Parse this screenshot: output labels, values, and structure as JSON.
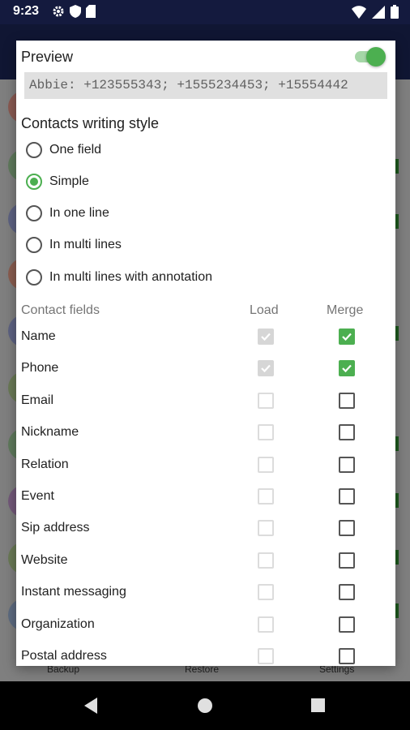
{
  "status_bar": {
    "time": "9:23",
    "left_icons": [
      "gear-icon",
      "shield-icon",
      "sd-card-icon"
    ],
    "right_icons": [
      "wifi-icon",
      "signal-icon",
      "battery-icon"
    ]
  },
  "background_tabs": [
    "Backup",
    "Restore",
    "Settings"
  ],
  "dialog": {
    "preview_title": "Preview",
    "preview_enabled": true,
    "preview_text": "Abbie: +123555343; +1555234453; +15554442",
    "writing_style_title": "Contacts writing style",
    "writing_styles": [
      {
        "label": "One field",
        "selected": false
      },
      {
        "label": "Simple",
        "selected": true
      },
      {
        "label": "In one line",
        "selected": false
      },
      {
        "label": "In multi lines",
        "selected": false
      },
      {
        "label": "In multi lines with annotation",
        "selected": false
      }
    ],
    "columns": {
      "fields": "Contact fields",
      "load": "Load",
      "merge": "Merge"
    },
    "fields": [
      {
        "label": "Name",
        "load": true,
        "merge": true
      },
      {
        "label": "Phone",
        "load": true,
        "merge": true
      },
      {
        "label": "Email",
        "load": false,
        "merge": false
      },
      {
        "label": "Nickname",
        "load": false,
        "merge": false
      },
      {
        "label": "Relation",
        "load": false,
        "merge": false
      },
      {
        "label": "Event",
        "load": false,
        "merge": false
      },
      {
        "label": "Sip address",
        "load": false,
        "merge": false
      },
      {
        "label": "Website",
        "load": false,
        "merge": false
      },
      {
        "label": "Instant messaging",
        "load": false,
        "merge": false
      },
      {
        "label": "Organization",
        "load": false,
        "merge": false
      },
      {
        "label": "Postal address",
        "load": false,
        "merge": false
      }
    ]
  },
  "colors": {
    "accent": "#4caf50",
    "status_bar": "#141a3e",
    "scrim_background": "#7f7f7f"
  },
  "nav_bar": [
    "back-icon",
    "home-icon",
    "recents-icon"
  ]
}
